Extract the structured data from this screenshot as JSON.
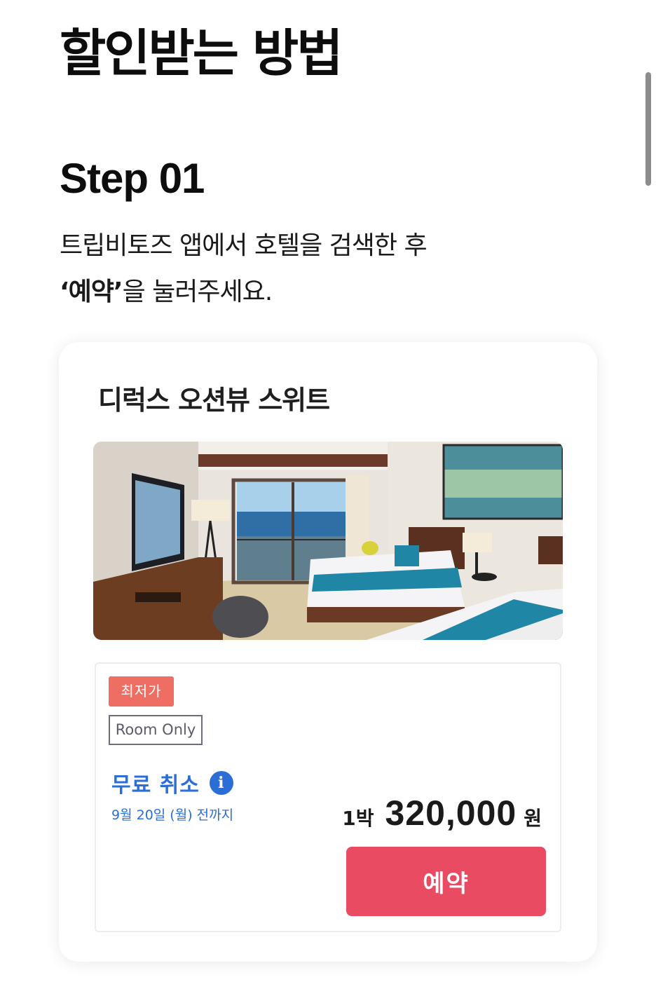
{
  "header": {
    "title": "할인받는 방법"
  },
  "step": {
    "title": "Step 01",
    "line1": "트립비토즈 앱에서 호텔을 검색한 후",
    "line2_bold": "‘예약’",
    "line2_rest": "을 눌러주세요."
  },
  "card": {
    "room_name": "디럭스 오션뷰 스위트",
    "photo_icon": "hotel-room-photo",
    "rate": {
      "badge_lowest": "최저가",
      "badge_room": "Room Only",
      "cancel_label": "무료 취소",
      "info_icon": "info-icon",
      "cancel_until": "9월 20일 (월) 전까지",
      "nights": "1박",
      "price": "320,000",
      "currency": "원",
      "reserve_label": "예약"
    }
  },
  "colors": {
    "accent_red": "#e94b63",
    "badge_red": "#ee6e63",
    "link_blue": "#2a6ed6"
  }
}
